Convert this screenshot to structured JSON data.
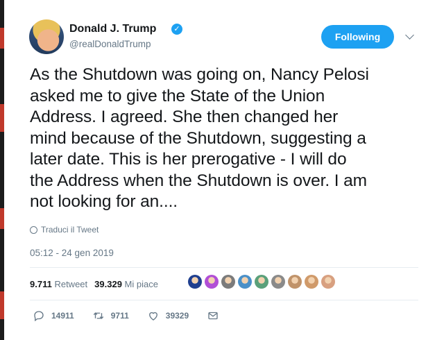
{
  "user": {
    "name": "Donald J. Trump",
    "handle": "@realDonaldTrump"
  },
  "follow_button": "Following",
  "tweet_text": "As the Shutdown was going on, Nancy Pelosi\nasked me to give the State of the Union\nAddress. I agreed. She then changed her\nmind because of the Shutdown, suggesting a\nlater date. This is her prerogative - I will do\nthe Address when the Shutdown is over. I am\nnot looking for an....",
  "translate_label": "Traduci il Tweet",
  "timestamp": "05:12 - 24 gen 2019",
  "stats": {
    "retweets_count": "9.711",
    "retweets_label": "Retweet",
    "likes_count": "39.329",
    "likes_label": "Mi piace"
  },
  "liker_avatar_colors": [
    "#1f3f8f",
    "#b14fd6",
    "#7b7b7b",
    "#4a90c8",
    "#5aa07a",
    "#8a8a8a",
    "#c0936a",
    "#d09a6a",
    "#d8a080"
  ],
  "actions": {
    "replies": "14911",
    "retweets": "9711",
    "likes": "39329"
  },
  "colors": {
    "accent": "#1da1f2",
    "secondary_text": "#657786"
  }
}
